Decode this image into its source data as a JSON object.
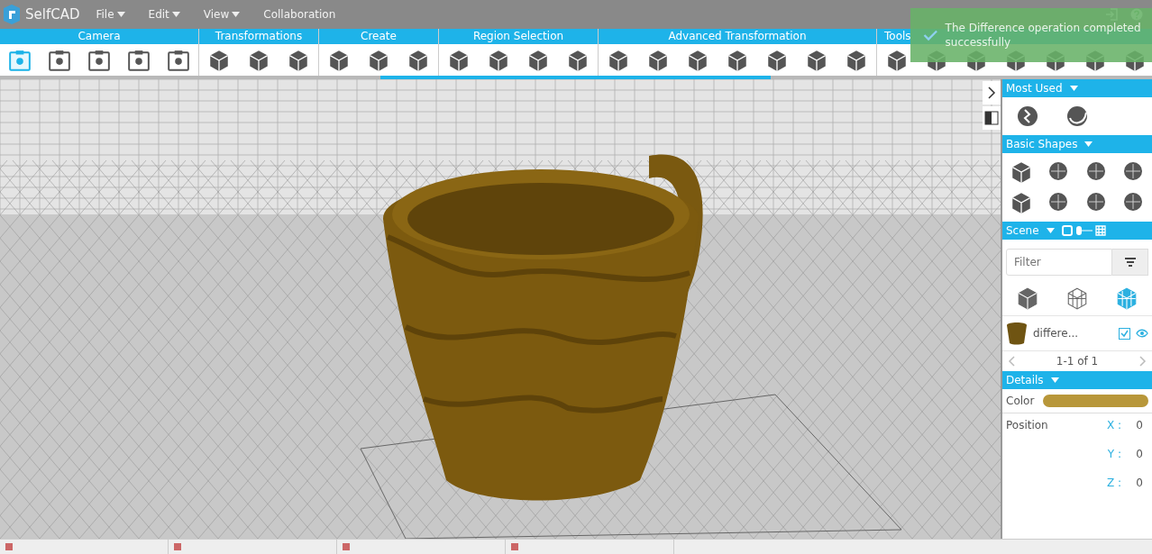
{
  "top_bar": {
    "logo": "SelfCAD",
    "menus": [
      {
        "label": "File",
        "dropdown": true
      },
      {
        "label": "Edit",
        "dropdown": true
      },
      {
        "label": "View",
        "dropdown": true
      },
      {
        "label": "Collaboration",
        "dropdown": false
      }
    ]
  },
  "toolbar": {
    "categories": [
      {
        "label": "Camera",
        "kind": "frame",
        "tools": [
          {
            "selected": true
          },
          {
            "selected": false
          },
          {
            "selected": false
          },
          {
            "selected": false
          },
          {
            "selected": false
          }
        ]
      },
      {
        "label": "Transformations",
        "kind": "cube",
        "tools": [
          {
            "selected": false
          },
          {
            "selected": false
          },
          {
            "selected": false
          }
        ]
      },
      {
        "label": "Create",
        "kind": "cube",
        "tools": [
          {
            "selected": false
          },
          {
            "selected": false
          },
          {
            "selected": false
          }
        ]
      },
      {
        "label": "Region Selection",
        "kind": "cube",
        "tools": [
          {
            "selected": false
          },
          {
            "selected": false
          },
          {
            "selected": false
          },
          {
            "selected": false
          }
        ]
      },
      {
        "label": "Advanced Transformation",
        "kind": "cube",
        "tools": [
          {
            "selected": false
          },
          {
            "selected": false
          },
          {
            "selected": false
          },
          {
            "selected": false
          },
          {
            "selected": false
          },
          {
            "selected": false
          },
          {
            "selected": false
          }
        ]
      },
      {
        "label": "Tools",
        "kind": "cube",
        "tools": [
          {
            "selected": false
          },
          {
            "selected": false
          },
          {
            "selected": false
          },
          {
            "selected": false
          },
          {
            "selected": false
          },
          {
            "selected": false
          },
          {
            "selected": false
          }
        ]
      }
    ]
  },
  "notification": {
    "message": "The Difference operation completed successfully"
  },
  "side_panel": {
    "sections": [
      {
        "title": "Most Used",
        "kind": "most_used"
      },
      {
        "title": "Basic Shapes",
        "kind": "shapes"
      },
      {
        "title": "Scene",
        "kind": "scene"
      }
    ],
    "filter": {
      "placeholder": "Filter"
    },
    "scene_views": [
      {
        "selected": false
      },
      {
        "selected": false
      },
      {
        "selected": true
      }
    ],
    "objects": [
      {
        "name": "differe...",
        "checked": true
      }
    ],
    "pager": "1-1 of 1",
    "details": {
      "title": "Details",
      "color_label": "Color",
      "color": "#b8973a",
      "position_label": "Position",
      "position": [
        {
          "axis": "X :",
          "value": "0"
        },
        {
          "axis": "Y :",
          "value": "0"
        },
        {
          "axis": "Z :",
          "value": "0"
        }
      ]
    }
  }
}
